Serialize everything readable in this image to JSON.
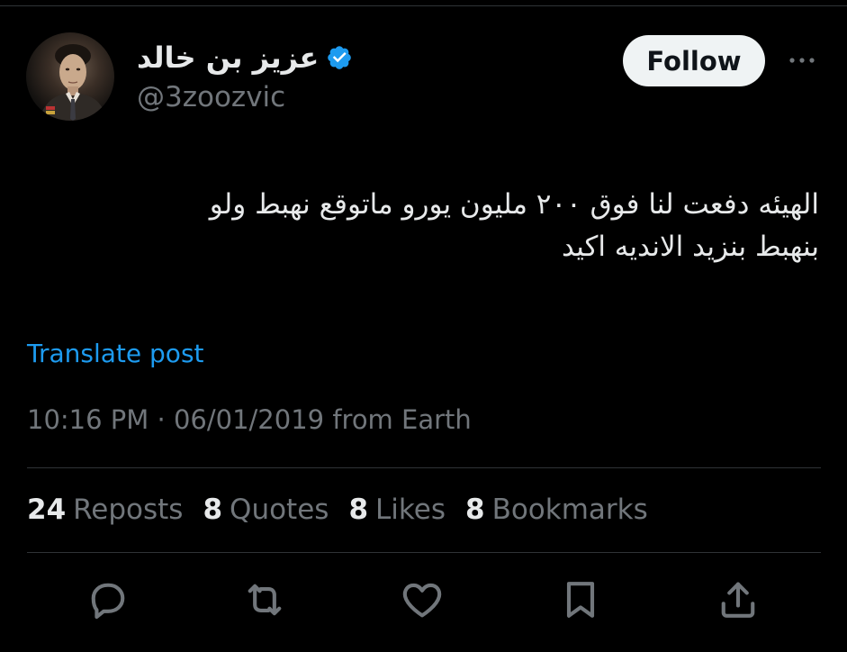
{
  "author": {
    "display_name": "عزيز بن خالد",
    "handle": "@3zoozvic",
    "verified": true
  },
  "follow_button": {
    "label": "Follow"
  },
  "tweet": {
    "text_line1": "الهيئه دفعت لنا فوق ٢٠٠ مليون يورو ماتوقع نهبط ولو",
    "text_line2": "بنهبط بنزيد الانديه اكيد",
    "translate_label": "Translate post",
    "timestamp": "10:16 PM · 06/01/2019 from Earth"
  },
  "stats": {
    "reposts": {
      "count": "24",
      "label": "Reposts"
    },
    "quotes": {
      "count": "8",
      "label": "Quotes"
    },
    "likes": {
      "count": "8",
      "label": "Likes"
    },
    "bookmarks": {
      "count": "8",
      "label": "Bookmarks"
    }
  },
  "icons": {
    "reply": "reply-icon",
    "repost": "repost-icon",
    "like": "heart-icon",
    "bookmark": "bookmark-icon",
    "share": "share-icon",
    "more": "more-icon",
    "verified": "verified-badge-icon"
  },
  "colors": {
    "background": "#000000",
    "text_primary": "#e7e9ea",
    "text_secondary": "#71767b",
    "link": "#1d9bf0",
    "verified": "#1d9bf0",
    "divider": "#2f3336",
    "follow_bg": "#eff3f4"
  }
}
